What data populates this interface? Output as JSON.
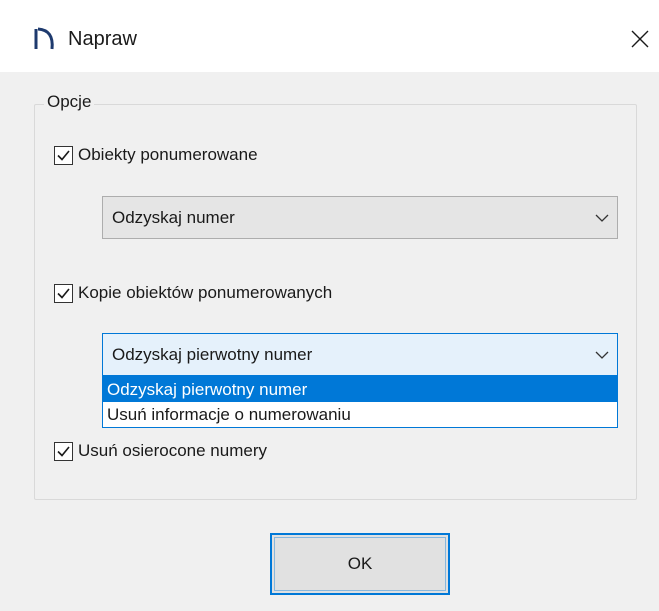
{
  "window": {
    "title": "Napraw",
    "close_glyph": "✕"
  },
  "group": {
    "legend": "Opcje"
  },
  "options": {
    "numbered_objects": {
      "label": "Obiekty ponumerowane",
      "checked": true
    },
    "numbered_action": {
      "value": "Odzyskaj numer"
    },
    "copies": {
      "label": "Kopie obiektów ponumerowanych",
      "checked": true
    },
    "copies_action": {
      "value": "Odzyskaj pierwotny numer",
      "options": [
        "Odzyskaj pierwotny numer",
        "Usuń informacje o numerowaniu"
      ]
    },
    "orphans": {
      "label": "Usuń osierocone numery",
      "checked": true
    }
  },
  "buttons": {
    "ok_label": "OK"
  },
  "colors": {
    "accent": "#0078d7",
    "titlebar_bg": "#ffffff",
    "dialog_bg": "#f0f0f0"
  },
  "icons": {
    "app": "app-logo-icon",
    "close": "close-icon",
    "check": "check-icon",
    "dropdown": "chevron-down-icon"
  }
}
